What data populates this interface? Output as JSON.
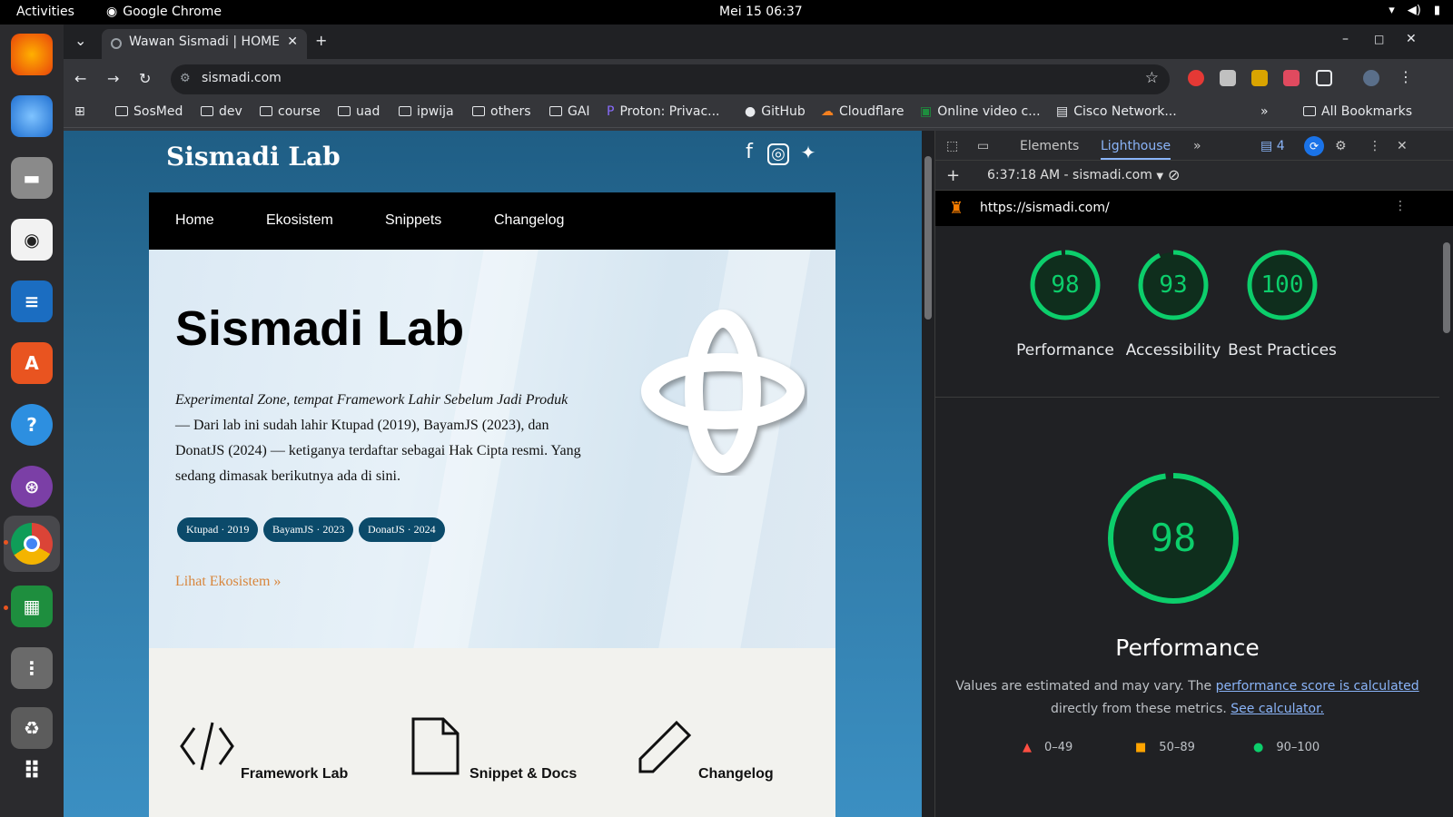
{
  "system": {
    "activities": "Activities",
    "app_name": "Google Chrome",
    "clock": "Mei 15  06:37"
  },
  "browser": {
    "tab_title": "Wawan Sismadi | HOME",
    "url": "sismadi.com",
    "bookmarks": [
      "SosMed",
      "dev",
      "course",
      "uad",
      "ipwija",
      "others",
      "GAI",
      "Proton: Privac...",
      "GitHub",
      "Cloudflare",
      "Online video c...",
      "Cisco Network..."
    ],
    "all_bookmarks": "All Bookmarks",
    "more_bookmarks": "»"
  },
  "site": {
    "brand": "Sismadi Lab",
    "nav": [
      "Home",
      "Ekosistem",
      "Snippets",
      "Changelog"
    ],
    "hero_title": "Sismadi Lab",
    "hero_text_em": "Experimental Zone, tempat Framework Lahir Sebelum Jadi Produk",
    "hero_text": " — Dari lab ini sudah lahir Ktupad (2019), BayamJS (2023), dan DonatJS (2024) — ketiganya terdaftar sebagai Hak Cipta resmi. Yang sedang dimasak berikutnya ada di sini.",
    "pills": [
      "Ktupad · 2019",
      "BayamJS · 2023",
      "DonatJS · 2024"
    ],
    "link": "Lihat Ekosistem »",
    "features": [
      "Framework Lab",
      "Snippet & Docs",
      "Changelog"
    ]
  },
  "devtools": {
    "tabs": [
      "Elements",
      "Lighthouse"
    ],
    "issues_count": "4",
    "report": "6:37:18 AM - sismadi.com",
    "audited_url": "https://sismadi.com/",
    "scores": [
      {
        "label": "Performance",
        "value": "98"
      },
      {
        "label": "Accessibility",
        "value": "93"
      },
      {
        "label": "Best Practices",
        "value": "100"
      }
    ],
    "main_score": "98",
    "main_title": "Performance",
    "desc_pre": "Values are estimated and may vary. The ",
    "desc_link1": "performance score is calculated",
    "desc_mid": " directly from these metrics. ",
    "desc_link2": "See calculator.",
    "legend": [
      "0–49",
      "50–89",
      "90–100"
    ],
    "colors": {
      "good": "#0cce6b",
      "average": "#ffa400",
      "fail": "#ff4e42"
    }
  }
}
